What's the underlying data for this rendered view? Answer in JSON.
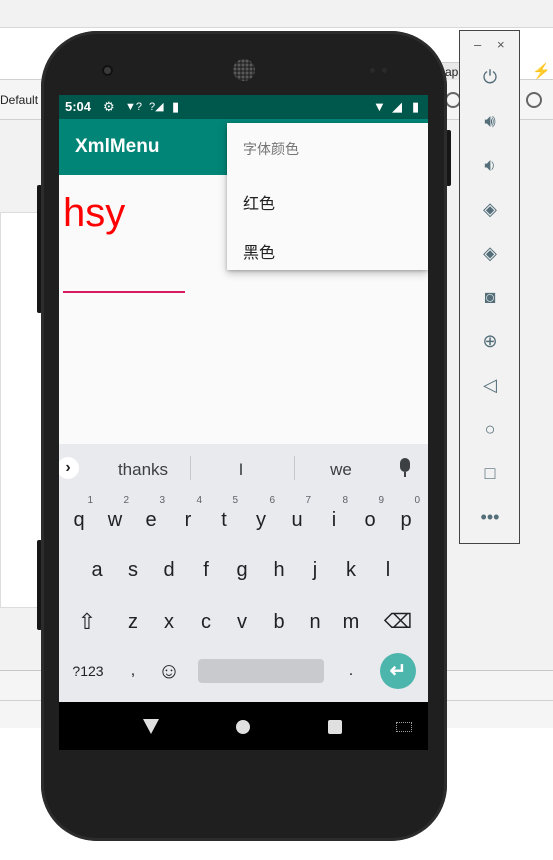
{
  "ide": {
    "default_label": "Default",
    "app_chip_label": "ap",
    "bolt_icon": "bolt-icon"
  },
  "status_bar": {
    "time": "5:04",
    "icons": [
      "gear-icon",
      "wifi-question-icon",
      "signal-question-icon",
      "sd-card-icon",
      "wifi-icon",
      "signal-icon",
      "battery-icon"
    ]
  },
  "app_bar": {
    "title": "XmlMenu"
  },
  "content": {
    "text": "hsy",
    "text_color": "#ff0000",
    "underline_color": "#d81b60"
  },
  "menu": {
    "header": "字体颜色",
    "items": [
      {
        "label": "红色"
      },
      {
        "label": "黑色"
      }
    ]
  },
  "keyboard": {
    "suggestions": [
      "thanks",
      "I",
      "we"
    ],
    "row1": [
      {
        "key": "q",
        "hint": "1"
      },
      {
        "key": "w",
        "hint": "2"
      },
      {
        "key": "e",
        "hint": "3"
      },
      {
        "key": "r",
        "hint": "4"
      },
      {
        "key": "t",
        "hint": "5"
      },
      {
        "key": "y",
        "hint": "6"
      },
      {
        "key": "u",
        "hint": "7"
      },
      {
        "key": "i",
        "hint": "8"
      },
      {
        "key": "o",
        "hint": "9"
      },
      {
        "key": "p",
        "hint": "0"
      }
    ],
    "row2": [
      "a",
      "s",
      "d",
      "f",
      "g",
      "h",
      "j",
      "k",
      "l"
    ],
    "row3": [
      "z",
      "x",
      "c",
      "v",
      "b",
      "n",
      "m"
    ],
    "symbols_label": "?123",
    "comma": ",",
    "period": "."
  },
  "emulator_panel": {
    "minimize": "–",
    "close": "×",
    "buttons": [
      "power-icon",
      "volume-up-icon",
      "volume-down-icon",
      "rotate-left-icon",
      "rotate-right-icon",
      "camera-icon",
      "zoom-icon",
      "back-icon",
      "home-icon",
      "overview-icon",
      "more-icon"
    ]
  },
  "colors": {
    "app_bar": "#008577",
    "status_bar": "#00574b",
    "enter_key": "#4db6ac"
  }
}
